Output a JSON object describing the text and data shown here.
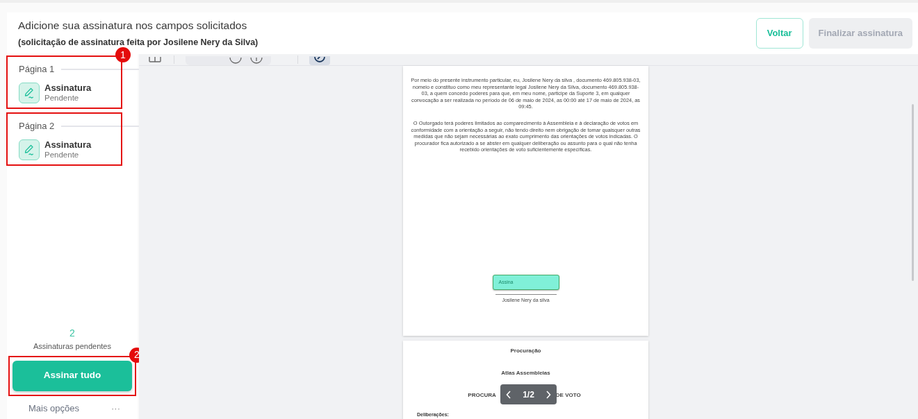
{
  "header": {
    "title": "Adicione sua assinatura nos campos solicitados",
    "subtitle": "(solicitação de assinatura feita por Josilene Nery da Silva)",
    "buttons": [
      {
        "label": "Voltar",
        "kind": "outline",
        "disabled": false
      },
      {
        "label": "Finalizar assinatura",
        "kind": "primary",
        "disabled": true
      }
    ]
  },
  "sidebar": {
    "pages": [
      {
        "label": "Página 1",
        "outlined": true,
        "callout": "1",
        "fields": [
          {
            "name": "Assinatura",
            "status": "Pendente"
          }
        ]
      },
      {
        "label": "Página 2",
        "outlined": true,
        "fields": [
          {
            "name": "Assinatura",
            "status": "Pendente"
          }
        ]
      }
    ],
    "pending_count": "2",
    "pending_label": "Assinaturas pendentes",
    "sign_all": {
      "label": "Assinar tudo",
      "outlined": true,
      "callout": "2"
    },
    "more_options": "Mais opções",
    "more_icon": "···"
  },
  "document": {
    "pages": [
      {
        "kind": "body",
        "paragraphs": [
          "Por meio do presente instrumento particular, eu, Josilene Nery da silva , documento 469.805.938-03, nomeio e constituo como meu representante legal Josilene Nery da Silva, documento 469.805.938-03, a quem concedo poderes para que, em meu nome, participe da Suporte 3, em qualquer convocação a ser realizada no período de 06 de maio de 2024, as 00:00 até 17 de maio de 2024, as 09:45.",
          "O Outorgado terá poderes limitados ao comparecimento à Assembleia e à declaração de votos em conformidade com a orientação a seguir, não tendo direito nem obrigação de tomar quaisquer outras medidas que não sejam necessárias ao exato cumprimento das orientações de votos indicadas. O procurador fica autorizado a se abster em qualquer deliberação ou assunto para o qual não tenha recebido orientações de voto suficientemente específicas."
        ],
        "signature_field": "Assina",
        "signer": "Josilene Nery da silva"
      },
      {
        "kind": "cover",
        "lines": [
          "Procuração",
          "Atlas Assembleias"
        ],
        "title_parts": [
          "PROCURA",
          "DE VOTO"
        ],
        "section": "Deliberações:"
      }
    ],
    "pager": "1/2"
  }
}
